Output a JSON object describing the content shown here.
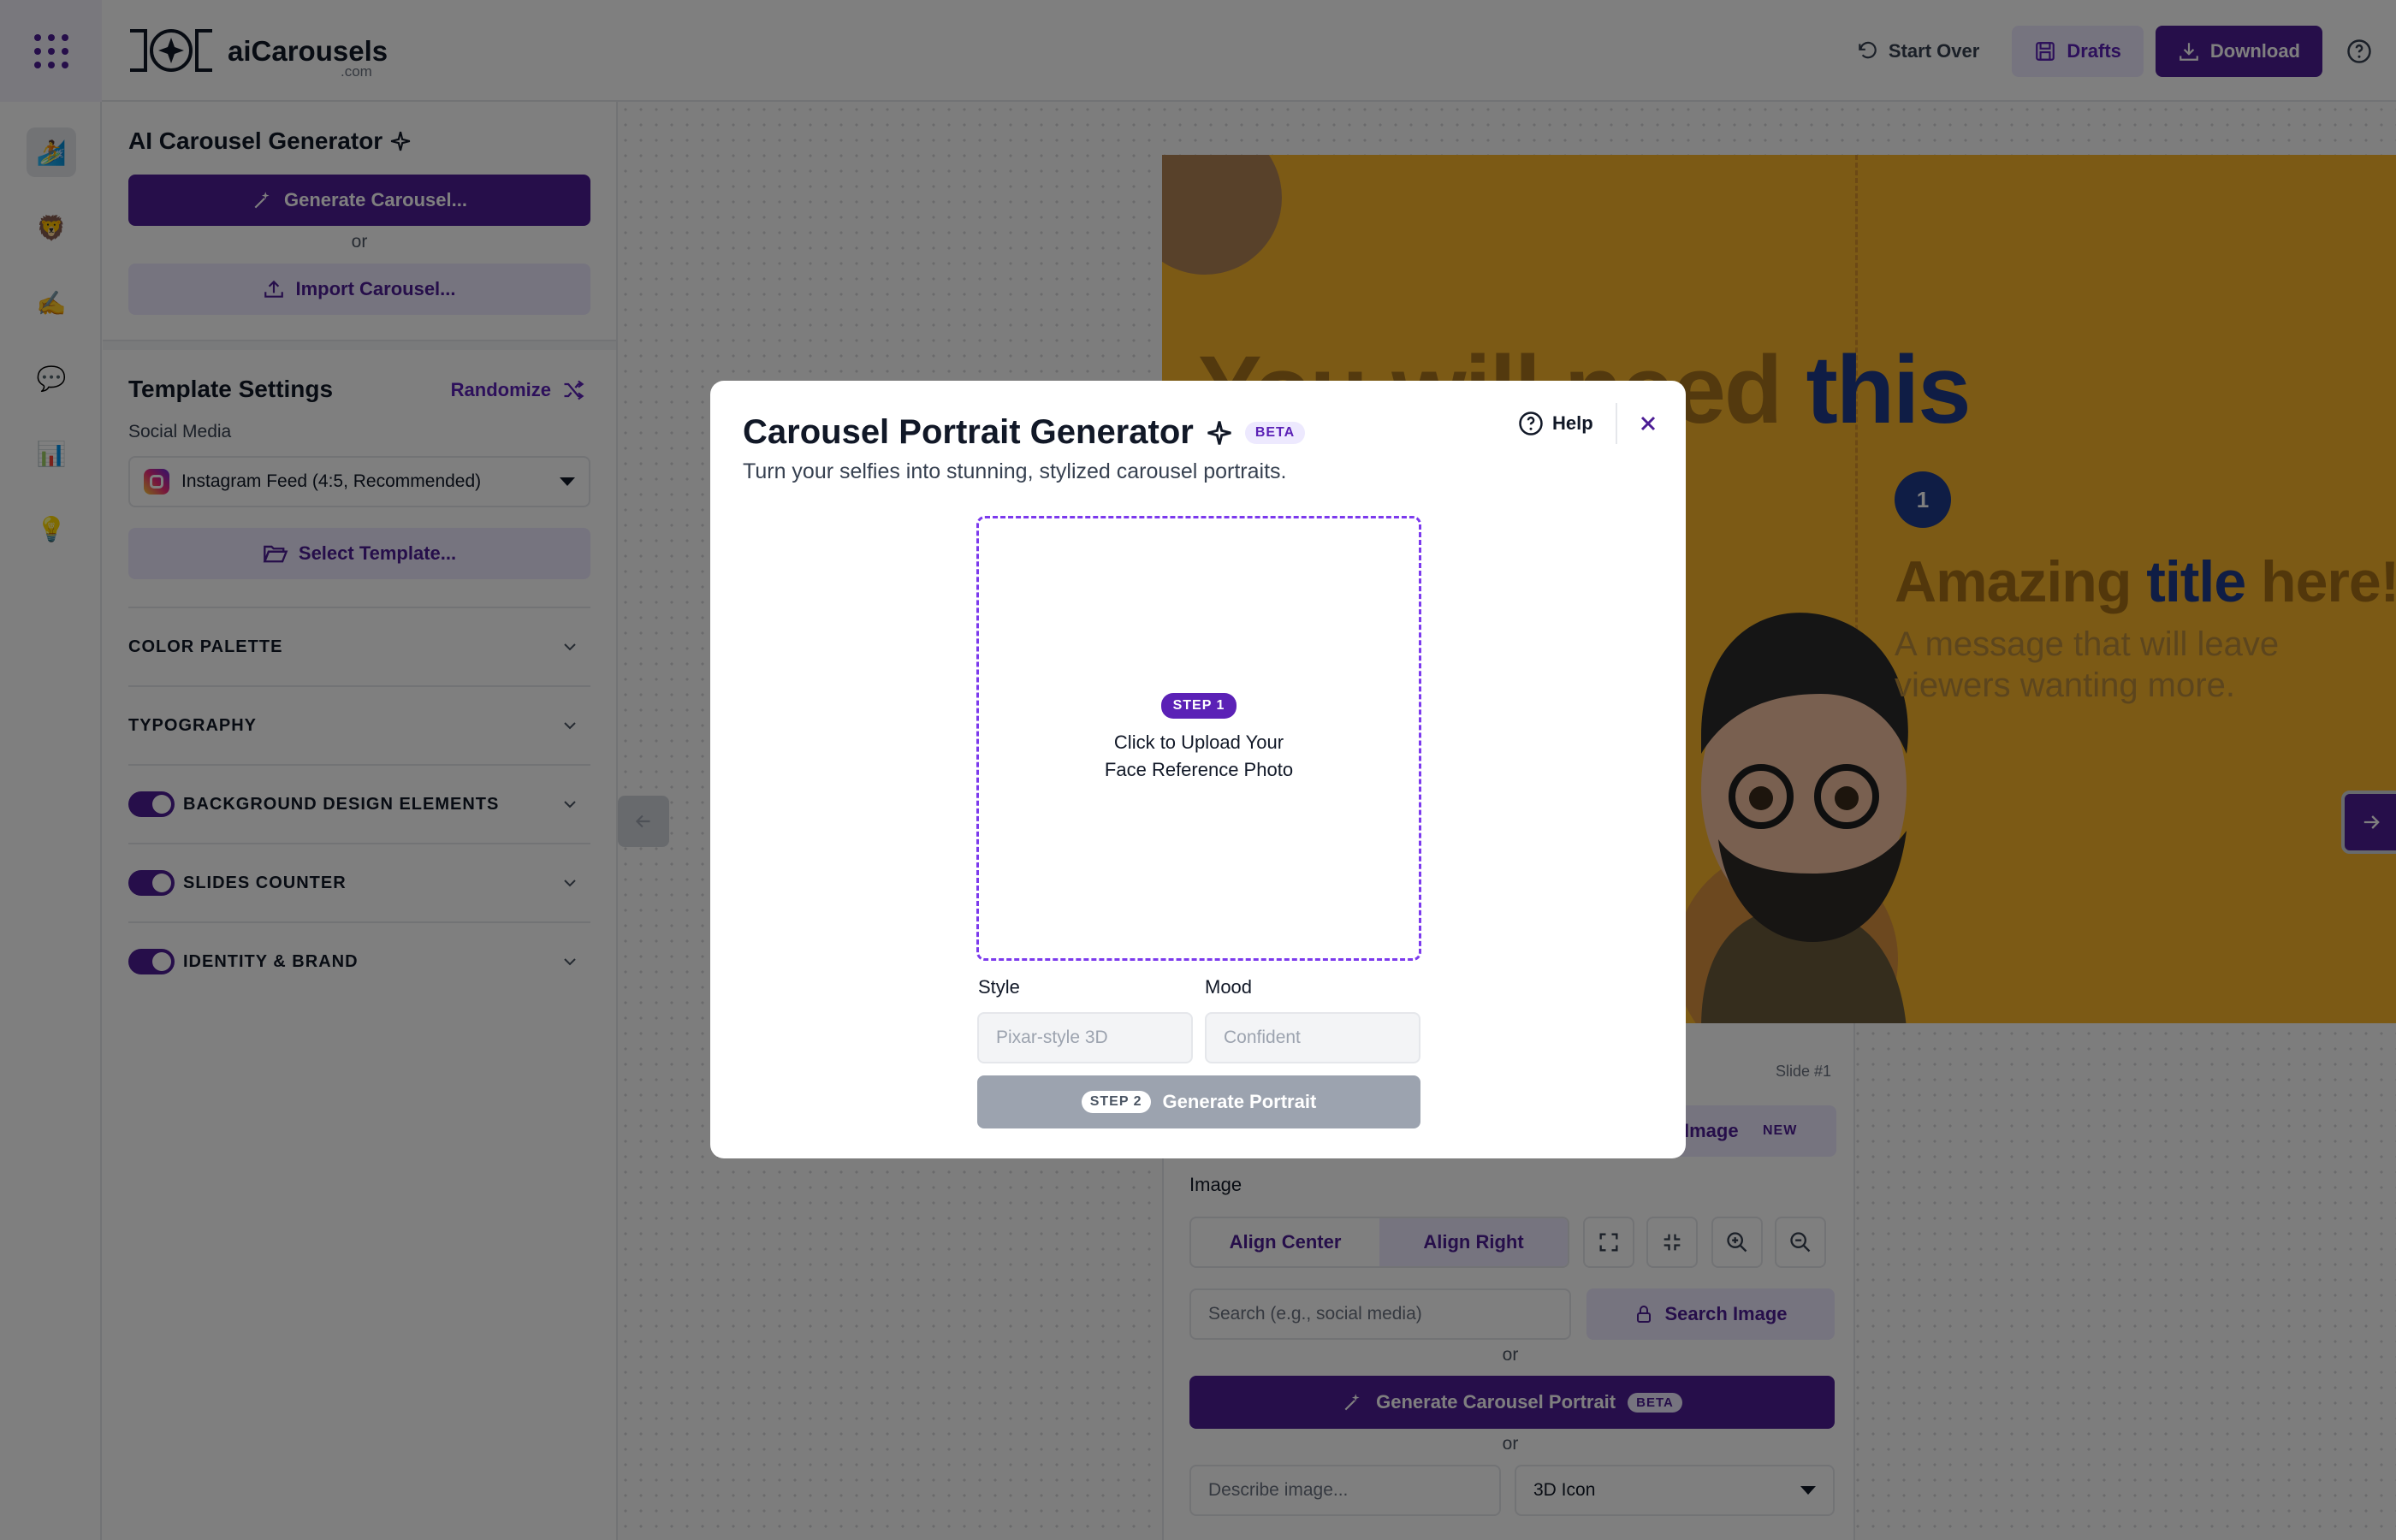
{
  "header": {
    "logo_name": "aiCarousels",
    "logo_suffix": ".com",
    "start_over": "Start Over",
    "drafts": "Drafts",
    "download": "Download"
  },
  "sidebar_left": {
    "title": "AI Carousel Generator",
    "generate_btn": "Generate Carousel...",
    "or": "or",
    "import_btn": "Import Carousel...",
    "template_settings": "Template Settings",
    "randomize": "Randomize",
    "social_media_label": "Social Media",
    "social_media_value": "Instagram Feed (4:5, Recommended)",
    "select_template": "Select Template...",
    "sections": [
      {
        "label": "COLOR PALETTE",
        "toggle": false
      },
      {
        "label": "TYPOGRAPHY",
        "toggle": false
      },
      {
        "label": "BACKGROUND DESIGN ELEMENTS",
        "toggle": true
      },
      {
        "label": "SLIDES COUNTER",
        "toggle": true
      },
      {
        "label": "IDENTITY & BRAND",
        "toggle": true
      }
    ]
  },
  "rail": {
    "items": [
      "🏄",
      "🦁",
      "✍️",
      "💬",
      "📊",
      "💡"
    ]
  },
  "slide": {
    "ghost_title_a": "You will need ",
    "ghost_title_b": "this",
    "counter": "1",
    "title_a": "Amazing ",
    "title_b": "title",
    "title_c": " here!",
    "subtitle": "A message that will leave viewers wanting more.",
    "background": "#f8b52a",
    "accent": "#1e3a8a"
  },
  "editor": {
    "slide_no": "Slide #1",
    "image_tab": "Image",
    "new_badge": "NEW",
    "image_label": "Image",
    "align_center": "Align Center",
    "align_right": "Align Right",
    "search_placeholder": "Search (e.g., social media)",
    "search_btn": "Search Image",
    "or": "or",
    "gen_portrait": "Generate Carousel Portrait",
    "beta": "BETA",
    "describe_placeholder": "Describe image...",
    "style_value": "3D Icon"
  },
  "modal": {
    "title": "Carousel Portrait Generator",
    "beta": "BETA",
    "subtitle": "Turn your selfies into stunning, stylized carousel portraits.",
    "help": "Help",
    "step1": "STEP 1",
    "upload_line1": "Click to Upload Your",
    "upload_line2": "Face Reference Photo",
    "style_label": "Style",
    "style_placeholder": "Pixar-style 3D",
    "mood_label": "Mood",
    "mood_placeholder": "Confident",
    "step2": "STEP 2",
    "generate": "Generate Portrait"
  },
  "colors": {
    "brand": "#4c1d95",
    "brand_light": "#ede9fe"
  }
}
